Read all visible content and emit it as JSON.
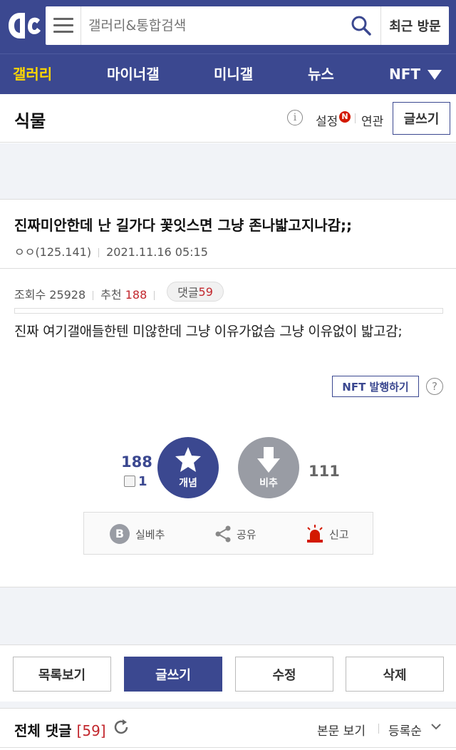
{
  "header": {
    "logo": "dc-logo",
    "search_placeholder": "갤러리&통합검색",
    "recent_label": "최근 방문"
  },
  "nav": {
    "items": [
      {
        "label": "갤러리",
        "active": true
      },
      {
        "label": "마이너갤",
        "active": false
      },
      {
        "label": "미니갤",
        "active": false
      },
      {
        "label": "뉴스",
        "active": false
      },
      {
        "label": "NFT",
        "active": false
      }
    ]
  },
  "gallery": {
    "title": "식물",
    "info_icon": "i",
    "setting_label": "설정",
    "new_badge": "N",
    "related_label": "연관",
    "write_label": "글쓰기"
  },
  "post": {
    "title": "진짜미안한데 난 길가다 꽃잇스면 그냥 존나밟고지나감;;",
    "author": "ㅇㅇ(125.141)",
    "date": "2021.11.16 05:15",
    "views_label": "조회수",
    "views": "25928",
    "recommend_label": "추천",
    "recommend": "188",
    "comments_label": "댓글",
    "comments": "59",
    "body": "진짜 여기갤애들한텐 미않한데 그냥 이유가없슴 그냥 이유없이 밟고감;",
    "nft_label": "NFT 발행하기",
    "help_icon": "?"
  },
  "vote": {
    "up_count": "188",
    "fix_count": "1",
    "up_label": "개념",
    "down_label": "비추",
    "down_count": "111"
  },
  "actions": {
    "silbe_label": "실베추",
    "silbe_icon": "B",
    "share_label": "공유",
    "report_label": "신고"
  },
  "bottom": {
    "list_label": "목록보기",
    "write_label": "글쓰기",
    "edit_label": "수정",
    "delete_label": "삭제"
  },
  "comments_header": {
    "title": "전체 댓글",
    "count": "[59]",
    "view_label": "본문 보기",
    "sort_label": "등록순"
  },
  "colors": {
    "brand": "#3b4890",
    "accent_yellow": "#ffd700",
    "red": "#c2272d",
    "gray_button": "#999ca4"
  }
}
